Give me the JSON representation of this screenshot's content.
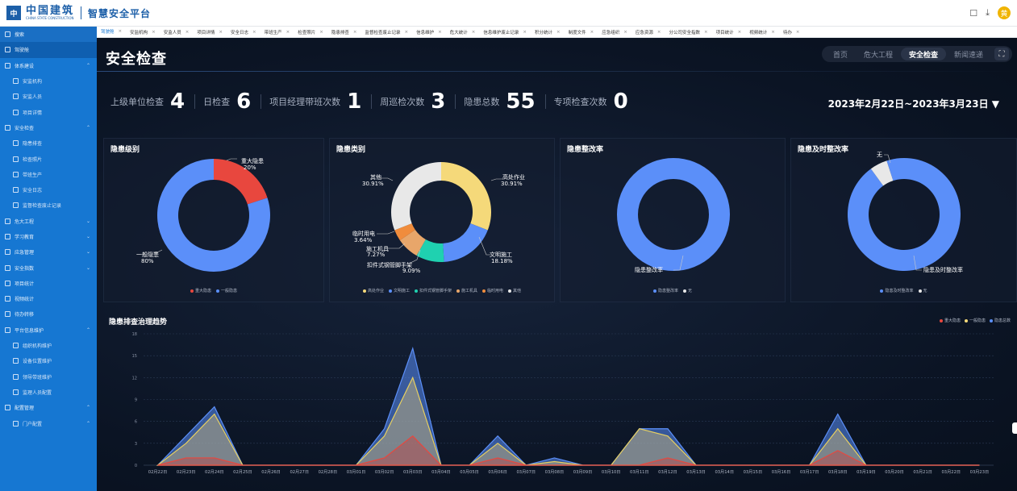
{
  "header": {
    "logo_cn": "中国建筑",
    "logo_en": "CHINA STATE CONSTRUCTION",
    "platform": "智慧安全平台",
    "avatar": "黄"
  },
  "sidebar": {
    "items": [
      {
        "label": "搜索",
        "level": 0,
        "chev": ""
      },
      {
        "label": "驾驶舱",
        "level": 0,
        "chev": ""
      },
      {
        "label": "体系建设",
        "level": 0,
        "chev": "^"
      },
      {
        "label": "安监机构",
        "level": 1,
        "chev": ""
      },
      {
        "label": "安监人员",
        "level": 1,
        "chev": ""
      },
      {
        "label": "项目详情",
        "level": 1,
        "chev": ""
      },
      {
        "label": "安全检查",
        "level": 0,
        "chev": "^"
      },
      {
        "label": "隐患排查",
        "level": 1,
        "chev": ""
      },
      {
        "label": "检查照片",
        "level": 1,
        "chev": ""
      },
      {
        "label": "带班生产",
        "level": 1,
        "chev": ""
      },
      {
        "label": "安全日志",
        "level": 1,
        "chev": ""
      },
      {
        "label": "监督检查废止记录",
        "level": 1,
        "chev": ""
      },
      {
        "label": "危大工程",
        "level": 0,
        "chev": "v"
      },
      {
        "label": "学习教育",
        "level": 0,
        "chev": "v"
      },
      {
        "label": "应急管理",
        "level": 0,
        "chev": "v"
      },
      {
        "label": "安全指数",
        "level": 0,
        "chev": "v"
      },
      {
        "label": "项目统计",
        "level": 0,
        "chev": ""
      },
      {
        "label": "视频统计",
        "level": 0,
        "chev": ""
      },
      {
        "label": "待办转移",
        "level": 0,
        "chev": ""
      },
      {
        "label": "平台信息维护",
        "level": 0,
        "chev": "^"
      },
      {
        "label": "组织机构维护",
        "level": 1,
        "chev": ""
      },
      {
        "label": "设备位置维护",
        "level": 1,
        "chev": ""
      },
      {
        "label": "领导带班维护",
        "level": 1,
        "chev": ""
      },
      {
        "label": "监理人员配置",
        "level": 1,
        "chev": ""
      },
      {
        "label": "配置管理",
        "level": 0,
        "chev": "^"
      },
      {
        "label": "门户配置",
        "level": 1,
        "chev": "^"
      }
    ]
  },
  "tabs": [
    "驾驶舱",
    "安监机构",
    "安监人员",
    "项目详情",
    "安全日志",
    "带班生产",
    "检查照片",
    "隐患排查",
    "监督检查废止记录",
    "信息维护",
    "危大统计",
    "信息维护废止记录",
    "积分统计",
    "制度文件",
    "应急组织",
    "应急资源",
    "分公司安全指数",
    "项目统计",
    "视频统计",
    "待办"
  ],
  "page": {
    "title": "安全检查",
    "nav": [
      "首页",
      "危大工程",
      "安全检查",
      "新闻速递"
    ],
    "nav_active": 2,
    "date_range": "2023年2月22日~2023年3月23日 ▼"
  },
  "stats": [
    {
      "label": "上级单位检查",
      "value": "4"
    },
    {
      "label": "日检查",
      "value": "6"
    },
    {
      "label": "项目经理带班次数",
      "value": "1"
    },
    {
      "label": "周巡检次数",
      "value": "3"
    },
    {
      "label": "隐患总数",
      "value": "55"
    },
    {
      "label": "专项检查次数",
      "value": "0"
    }
  ],
  "panels": [
    {
      "title": "隐患级别",
      "legend": [
        {
          "name": "重大隐患",
          "color": "#e8473e"
        },
        {
          "name": "一般隐患",
          "color": "#5b8ff9"
        }
      ]
    },
    {
      "title": "隐患类别",
      "legend": [
        {
          "name": "高处作业",
          "color": "#f5d97a"
        },
        {
          "name": "文明施工",
          "color": "#5b8ff9"
        },
        {
          "name": "扣件式钢管脚手架",
          "color": "#1fd1b0"
        },
        {
          "name": "施工机具",
          "color": "#e8a66a"
        },
        {
          "name": "临时用电",
          "color": "#f08c3c"
        },
        {
          "name": "其他",
          "color": "#e8e8e8"
        }
      ]
    },
    {
      "title": "隐患整改率",
      "legend": [
        {
          "name": "隐患整改率",
          "color": "#5b8ff9"
        },
        {
          "name": "无",
          "color": "#e8e8e8"
        }
      ]
    },
    {
      "title": "隐患及时整改率",
      "legend": [
        {
          "name": "隐患及时整改率",
          "color": "#5b8ff9"
        },
        {
          "name": "无",
          "color": "#e8e8e8"
        }
      ]
    }
  ],
  "pie_labels": {
    "p1": [
      "重大隐患",
      "20%",
      "一般隐患",
      "80%"
    ],
    "p2": [
      "其他",
      "30.91%",
      "高处作业",
      "30.91%",
      "临时用电",
      "3.64%",
      "施工机具",
      "7.27%",
      "扣件式钢管脚手架",
      "9.09%",
      "文明施工",
      "18.18%"
    ],
    "p3": [
      "隐患整改率"
    ],
    "p4": [
      "无",
      "隐患及时整改率"
    ]
  },
  "trend": {
    "title": "隐患排查治理趋势",
    "legend": [
      {
        "name": "重大隐患",
        "color": "#e8473e"
      },
      {
        "name": "一般隐患",
        "color": "#f5d97a"
      },
      {
        "name": "隐患总数",
        "color": "#5b8ff9"
      }
    ]
  },
  "chart_data": [
    {
      "type": "pie",
      "title": "隐患级别",
      "categories": [
        "重大隐患",
        "一般隐患"
      ],
      "values": [
        20,
        80
      ],
      "unit": "%"
    },
    {
      "type": "pie",
      "title": "隐患类别",
      "categories": [
        "高处作业",
        "文明施工",
        "扣件式钢管脚手架",
        "施工机具",
        "临时用电",
        "其他"
      ],
      "values": [
        30.91,
        18.18,
        9.09,
        7.27,
        3.64,
        30.91
      ],
      "unit": "%"
    },
    {
      "type": "pie",
      "title": "隐患整改率",
      "categories": [
        "隐患整改率",
        "无"
      ],
      "values": [
        100,
        0
      ]
    },
    {
      "type": "pie",
      "title": "隐患及时整改率",
      "categories": [
        "隐患及时整改率",
        "无"
      ],
      "values": [
        95,
        5
      ]
    },
    {
      "type": "area",
      "title": "隐患排查治理趋势",
      "x": [
        "02月22日",
        "02月23日",
        "02月24日",
        "02月25日",
        "02月26日",
        "02月27日",
        "02月28日",
        "03月01日",
        "03月02日",
        "03月03日",
        "03月04日",
        "03月05日",
        "03月06日",
        "03月07日",
        "03月08日",
        "03月09日",
        "03月10日",
        "03月11日",
        "03月12日",
        "03月13日",
        "03月14日",
        "03月15日",
        "03月16日",
        "03月17日",
        "03月18日",
        "03月19日",
        "03月20日",
        "03月21日",
        "03月22日",
        "03月23日"
      ],
      "ylim": [
        0,
        18
      ],
      "yticks": [
        0,
        3,
        6,
        9,
        12,
        15,
        18
      ],
      "series": [
        {
          "name": "隐患总数",
          "values": [
            0,
            4,
            8,
            0,
            0,
            0,
            0,
            0,
            5,
            16,
            0,
            0,
            4,
            0,
            1,
            0,
            0,
            5,
            5,
            0,
            0,
            0,
            0,
            0,
            7,
            0,
            0,
            0,
            0,
            0
          ]
        },
        {
          "name": "一般隐患",
          "values": [
            0,
            3,
            7,
            0,
            0,
            0,
            0,
            0,
            4,
            12,
            0,
            0,
            3,
            0,
            0.5,
            0,
            0,
            5,
            4,
            0,
            0,
            0,
            0,
            0,
            5,
            0,
            0,
            0,
            0,
            0
          ]
        },
        {
          "name": "重大隐患",
          "values": [
            0,
            1,
            1,
            0,
            0,
            0,
            0,
            0,
            1,
            4,
            0,
            0,
            1,
            0,
            0,
            0,
            0,
            0,
            1,
            0,
            0,
            0,
            0,
            0,
            2,
            0,
            0,
            0,
            0,
            0
          ]
        }
      ]
    }
  ]
}
